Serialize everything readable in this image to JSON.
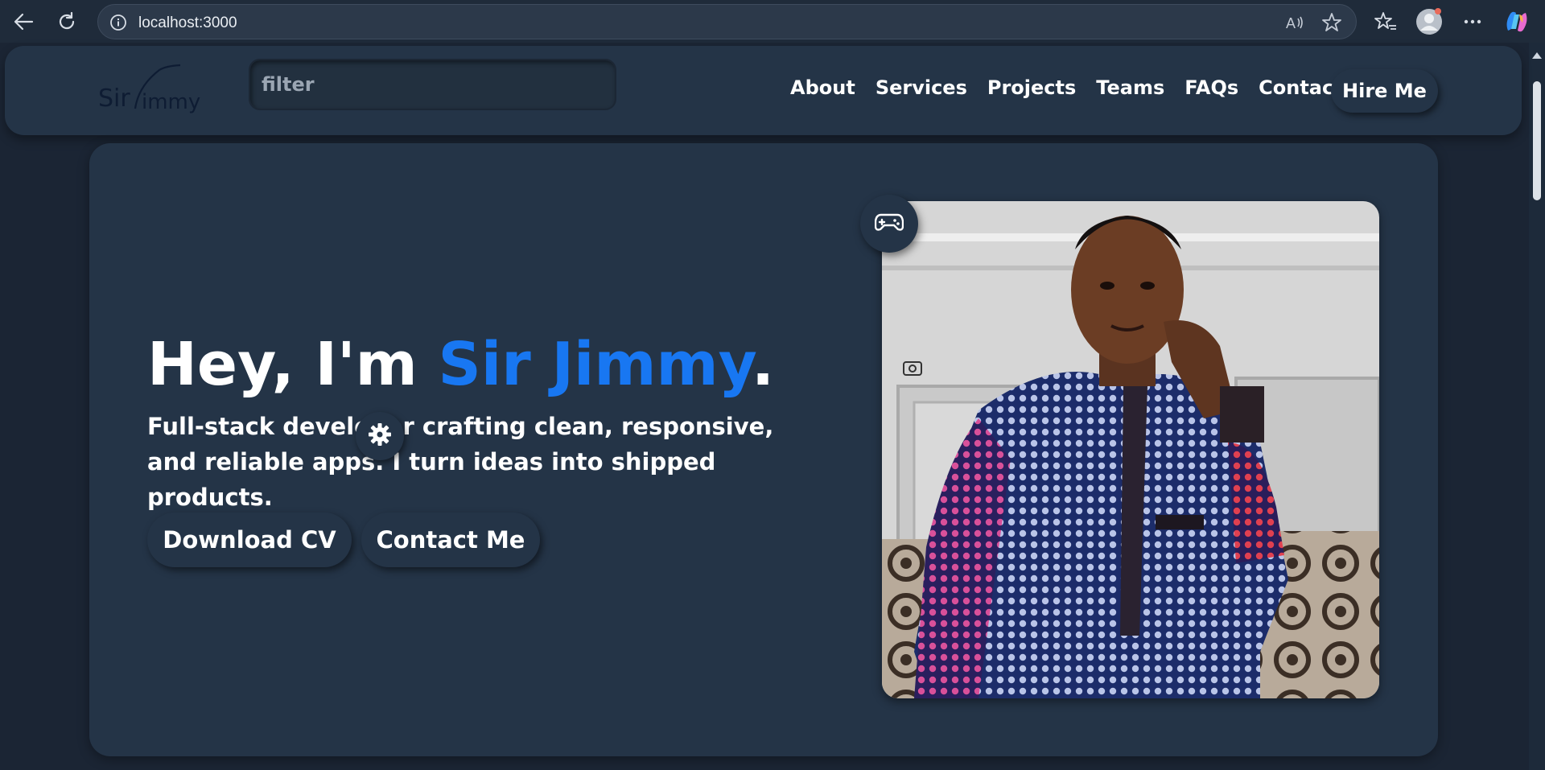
{
  "browser": {
    "url": "localhost:3000"
  },
  "nav": {
    "logo_text": "Sir Jimmy",
    "filter_placeholder": "filter",
    "links": [
      "About",
      "Services",
      "Projects",
      "Teams",
      "FAQs",
      "Contact"
    ],
    "hire_label": "Hire Me"
  },
  "hero": {
    "title_prefix": "Hey, I'm ",
    "title_name": "Sir Jimmy",
    "title_suffix": ".",
    "subtitle": "Full-stack developer crafting clean, responsive, and reliable apps. I turn ideas into shipped products.",
    "download_cv_label": "Download CV",
    "contact_label": "Contact Me"
  },
  "colors": {
    "accent": "#1877f2",
    "card_bg": "#243447",
    "page_bg": "#1b2534"
  },
  "icons": [
    "back-arrow-icon",
    "refresh-icon",
    "info-icon",
    "read-aloud-icon",
    "star-icon",
    "favorites-icon",
    "profile-icon",
    "more-icon",
    "copilot-icon",
    "gear-icon",
    "gamepad-icon"
  ]
}
